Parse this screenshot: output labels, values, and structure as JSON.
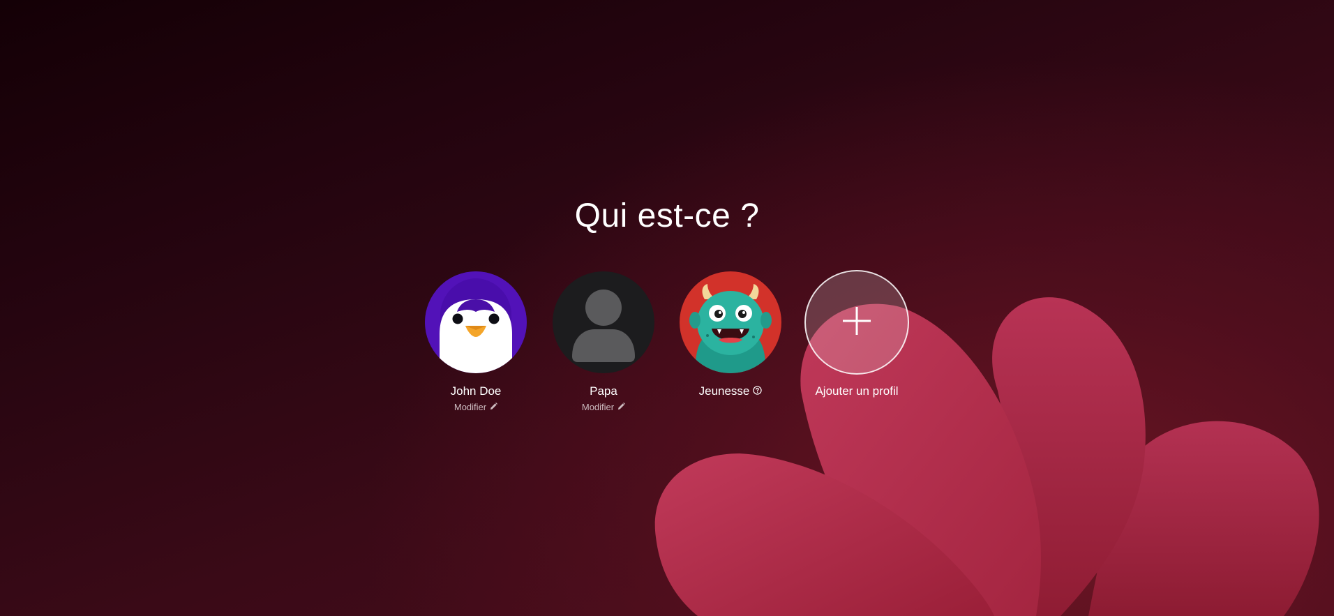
{
  "page": {
    "title": "Qui est-ce ?"
  },
  "profiles": [
    {
      "name": "John Doe",
      "edit_label": "Modifier",
      "avatar_icon": "penguin-icon",
      "avatar_color": "#4a0fa8"
    },
    {
      "name": "Papa",
      "edit_label": "Modifier",
      "avatar_icon": "person-silhouette-icon",
      "avatar_color": "#1c1c1e"
    },
    {
      "name": "Jeunesse",
      "info_icon": "question-circle-icon",
      "avatar_icon": "monster-icon",
      "avatar_color": "#d2322a"
    }
  ],
  "add_profile": {
    "label": "Ajouter un profil",
    "icon": "plus-icon"
  },
  "colors": {
    "background_dark": "#140006",
    "background_accent": "#4d0e1c",
    "petal": "#b02a48"
  }
}
